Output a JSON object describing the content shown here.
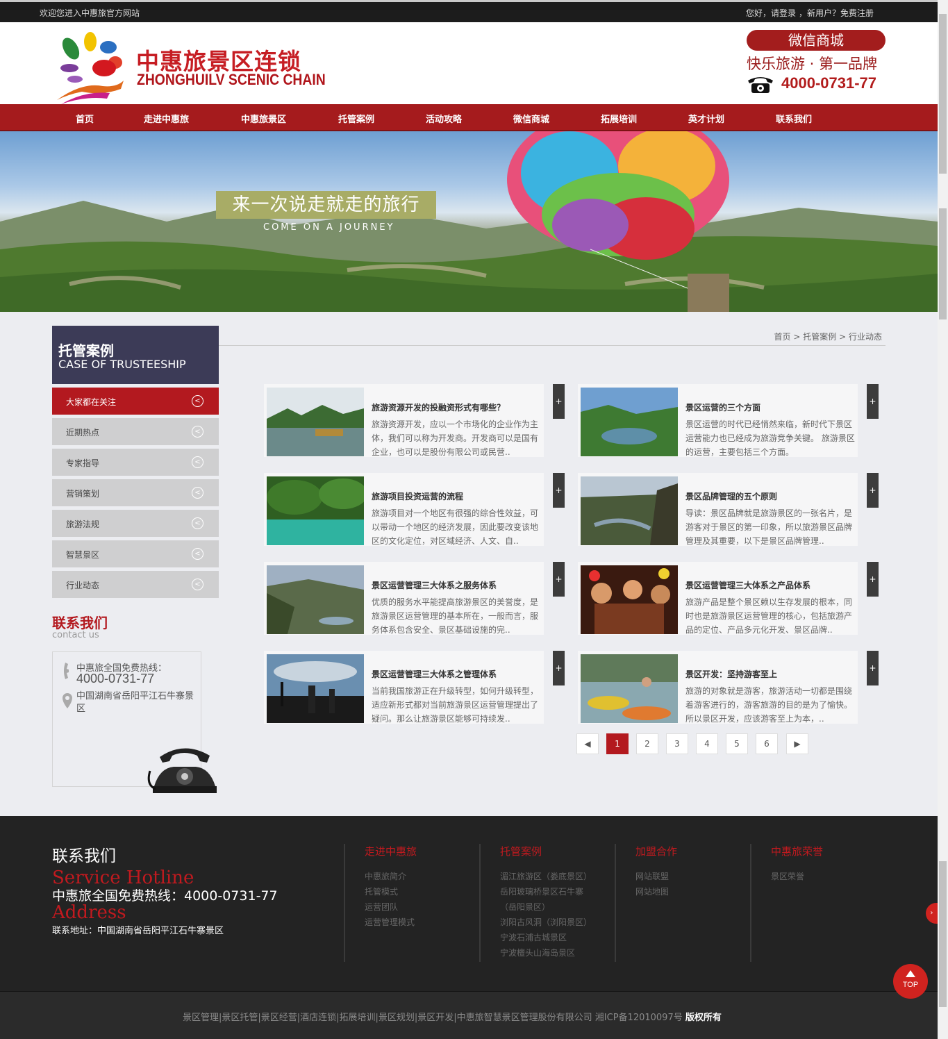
{
  "topbar": {
    "welcome": "欢迎您进入中惠旅官方网站",
    "greet": "您好，请登录",
    "newuser": "，新用户？",
    "register": "免费注册"
  },
  "header": {
    "logo_cn": "中惠旅景区连锁",
    "logo_en": "ZHONGHUILV SCENIC CHAIN",
    "wechat": "微信商城",
    "slogan": "快乐旅游 · 第一品牌",
    "phone": "4000-0731-77"
  },
  "nav": [
    "首页",
    "走进中惠旅",
    "中惠旅景区",
    "托管案例",
    "活动攻略",
    "微信商城",
    "拓展培训",
    "英才计划",
    "联系我们"
  ],
  "banner": {
    "title": "来一次说走就走的旅行",
    "subtitle": "COME ON A JOURNEY"
  },
  "sidebar": {
    "title_cn": "托管案例",
    "title_en": "CASE OF TRUSTEESHIP",
    "items": [
      "大家都在关注",
      "近期热点",
      "专家指导",
      "营销策划",
      "旅游法规",
      "智慧景区",
      "行业动态"
    ],
    "arrow": "<",
    "contact_title": "联系我们",
    "contact_sub": "contact us",
    "hotline_label": "中惠旅全国免费热线：",
    "hotline": "4000-0731-77",
    "address": "中国湖南省岳阳平江石牛寨景区"
  },
  "breadcrumb": {
    "home": "首页",
    "sep": ">",
    "section": "托管案例",
    "current": "行业动态"
  },
  "articles": [
    {
      "title": "旅游资源开发的投融资形式有哪些？",
      "desc": "旅游资源开发，应以一个市场化的企业作为主体，我们可以称为开发商。开发商可以是国有企业，也可以是股份有限公司或民营.."
    },
    {
      "title": "景区运营的三个方面",
      "desc": "景区运营的时代已经悄然来临，新时代下景区运营能力也已经成为旅游竞争关键。 旅游景区的运营，主要包括三个方面。"
    },
    {
      "title": "旅游项目投资运营的流程",
      "desc": "旅游项目对一个地区有很强的综合性效益，可以带动一个地区的经济发展，因此要改变该地区的文化定位，对区域经济、人文、自.."
    },
    {
      "title": "景区品牌管理的五个原则",
      "desc": "导读：景区品牌就是旅游景区的一张名片，是游客对于景区的第一印象，所以旅游景区品牌管理及其重要，以下是景区品牌管理.."
    },
    {
      "title": "景区运营管理三大体系之服务体系",
      "desc": "优质的服务水平能提高旅游景区的美誉度，是旅游景区运营管理的基本所在，一般而言，服务体系包含安全、景区基础设施的完.."
    },
    {
      "title": "景区运营管理三大体系之产品体系",
      "desc": "旅游产品是整个景区赖以生存发展的根本，同时也是旅游景区运营管理的核心，包括旅游产品的定位、产品多元化开发、景区品牌.."
    },
    {
      "title": "景区运营管理三大体系之管理体系",
      "desc": "当前我国旅游正在升级转型，如何升级转型，适应新形式都对当前旅游景区运营管理提出了疑问。那么让旅游景区能够可持续发.."
    },
    {
      "title": "景区开发：坚持游客至上",
      "desc": "旅游的对象就是游客，旅游活动一切都是围绕着游客进行的，游客旅游的目的是为了愉快。所以景区开发，应该游客至上为本，.."
    }
  ],
  "plus": "+",
  "pager": {
    "prev": "◀",
    "pages": [
      "1",
      "2",
      "3",
      "4",
      "5",
      "6"
    ],
    "next": "▶"
  },
  "footer": {
    "title": "联系我们",
    "service": "Service Hotline",
    "hotline": "中惠旅全国免费热线：4000-0731-77",
    "address_h": "Address",
    "address": "联系地址：中国湖南省岳阳平江石牛寨景区",
    "cols": [
      {
        "h": "走进中惠旅",
        "links": [
          "中惠旅简介",
          "托管模式",
          "运营团队",
          "运营管理模式"
        ]
      },
      {
        "h": "托管案例",
        "links": [
          "湄江旅游区（娄底景区）",
          "岳阳玻璃桥景区石牛寨",
          "（岳阳景区）",
          "浏阳古风洞（浏阳景区）",
          "宁波石浦古城景区",
          "宁波檀头山海岛景区"
        ]
      },
      {
        "h": "加盟合作",
        "links": [
          "网站联盟",
          "网站地图"
        ]
      },
      {
        "h": "中惠旅荣誉",
        "links": [
          "景区荣誉"
        ]
      }
    ],
    "copyright": "景区管理|景区托管|景区经营|酒店连锁|拓展培训|景区规划|景区开发|中惠旅智慧景区管理股份有限公司 湘ICP备12010097号",
    "rights": "版权所有"
  },
  "top_button": "TOP",
  "colors": {
    "brand_red": "#a51b1d",
    "sidebar_dark": "#3c3b57",
    "footer_bg": "#232323"
  }
}
